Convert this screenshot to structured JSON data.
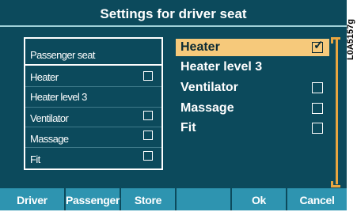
{
  "title": "Settings for driver seat",
  "side_label": "L0A5157g",
  "small_panel": {
    "header": "Passenger seat",
    "items": [
      {
        "label": "Heater",
        "has_checkbox": true,
        "checked": false
      },
      {
        "label": "Heater level 3",
        "has_checkbox": false,
        "checked": false
      },
      {
        "label": "Ventilator",
        "has_checkbox": true,
        "checked": false
      },
      {
        "label": "Massage",
        "has_checkbox": true,
        "checked": false
      },
      {
        "label": "Fit",
        "has_checkbox": true,
        "checked": false
      }
    ]
  },
  "main_list": {
    "items": [
      {
        "label": "Heater",
        "has_checkbox": true,
        "checked": true,
        "selected": true
      },
      {
        "label": "Heater level 3",
        "has_checkbox": false,
        "checked": false,
        "selected": false
      },
      {
        "label": "Ventilator",
        "has_checkbox": true,
        "checked": false,
        "selected": false
      },
      {
        "label": "Massage",
        "has_checkbox": true,
        "checked": false,
        "selected": false
      },
      {
        "label": "Fit",
        "has_checkbox": true,
        "checked": false,
        "selected": false
      }
    ]
  },
  "softkeys": [
    "Driver",
    "Passenger",
    "Store",
    "",
    "Ok",
    "Cancel"
  ],
  "colors": {
    "background": "#0c4a5c",
    "highlight": "#f6c97b",
    "softkey": "#2e94b0",
    "scrollbar": "#e8a640"
  }
}
